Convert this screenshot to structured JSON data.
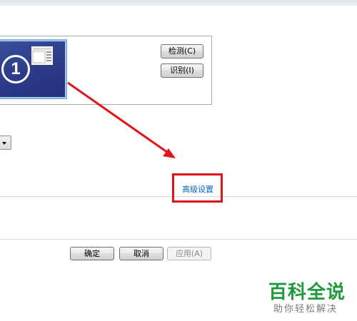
{
  "preview": {
    "monitor_number": "1",
    "detect_button": "检测(C)",
    "identify_button": "识别(I)"
  },
  "link": {
    "advanced_settings": "高级设置"
  },
  "footer": {
    "ok_button": "确定",
    "cancel_button": "取消",
    "apply_button": "应用(A)"
  },
  "watermark": {
    "title": "百科全说",
    "subtitle": "助你轻松解决"
  },
  "colors": {
    "annotation": "#e0151b",
    "link": "#0066cc",
    "watermark_green": "#1f9a3a"
  }
}
